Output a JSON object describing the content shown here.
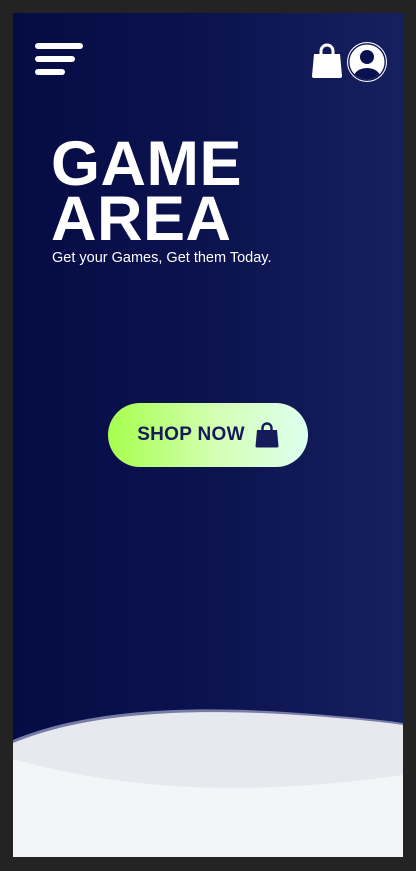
{
  "header": {
    "menu_icon": "hamburger-menu-icon",
    "cart_icon": "shopping-bag-icon",
    "profile_icon": "user-avatar-icon"
  },
  "hero": {
    "title_line1": "GAME",
    "title_line2": "AREA",
    "subtitle": "Get your Games, Get them Today."
  },
  "cta": {
    "label": "SHOP NOW",
    "icon": "shopping-bag-icon",
    "gradient": [
      "#a6ff4d",
      "#ddfff0"
    ]
  },
  "colors": {
    "background": "#050b44",
    "background_end": "#17205f",
    "text": "#ffffff",
    "cta_text": "#151a5b",
    "footer_wave": "#f4f5f8"
  }
}
